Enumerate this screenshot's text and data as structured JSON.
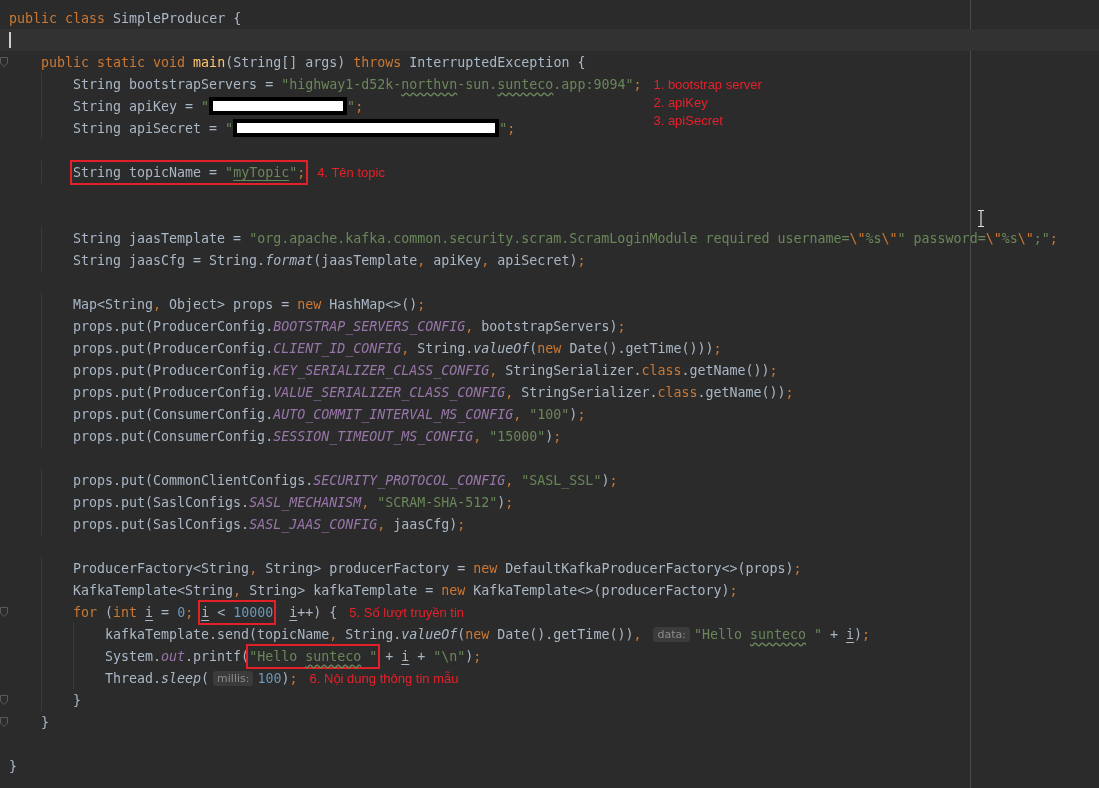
{
  "editor": {
    "lines": [
      {
        "fold": false,
        "current": false,
        "tokens": [
          {
            "kind": "keyword",
            "text": "public class "
          },
          {
            "kind": "plain",
            "text": "SimpleProducer {"
          }
        ],
        "children": [
          {
            "fold": false,
            "current": true
          },
          {
            "fold": true,
            "current": false,
            "tokens": [
              {
                "kind": "keyword",
                "text": "public static void "
              },
              {
                "kind": "method",
                "text": "main"
              },
              {
                "kind": "plain",
                "text": "(String[] args) "
              },
              {
                "kind": "keyword",
                "text": "throws "
              },
              {
                "kind": "plain",
                "text": "InterruptedException {"
              }
            ],
            "children": [
              {
                "fold": false,
                "current": false,
                "tokens": [
                  {
                    "kind": "plain",
                    "text": "String bootstrapServers = "
                  },
                  {
                    "kind": "string",
                    "text": "\"highway1-d52k-"
                  },
                  {
                    "kind": "string-wavy",
                    "text": "northvn"
                  },
                  {
                    "kind": "string",
                    "text": "-sun."
                  },
                  {
                    "kind": "string-wavy",
                    "text": "sunteco"
                  },
                  {
                    "kind": "string",
                    "text": ".app:9094\""
                  },
                  {
                    "kind": "punct",
                    "text": ";"
                  }
                ],
                "notes": [
                  "1. bootstrap server",
                  "2. apiKey",
                  "3. apiSecret"
                ]
              },
              {
                "fold": false,
                "current": false,
                "tokens": [
                  {
                    "kind": "plain",
                    "text": "String apiKey = "
                  },
                  {
                    "kind": "string",
                    "text": "\""
                  },
                  {
                    "kind": "redacted"
                  },
                  {
                    "kind": "string",
                    "text": "\""
                  },
                  {
                    "kind": "punct",
                    "text": ";"
                  }
                ]
              },
              {
                "fold": false,
                "current": false,
                "tokens": [
                  {
                    "kind": "plain",
                    "text": "String apiSecret = "
                  },
                  {
                    "kind": "string",
                    "text": "\""
                  },
                  {
                    "kind": "redacted"
                  },
                  {
                    "kind": "string",
                    "text": "\""
                  },
                  {
                    "kind": "punct",
                    "text": ";"
                  }
                ]
              },
              {
                "fold": false,
                "current": false
              },
              {
                "fold": false,
                "current": false,
                "tokens": [
                  {
                    "kind": "box",
                    "items": [
                      {
                        "kind": "plain",
                        "text": "String topicName = "
                      },
                      {
                        "kind": "string",
                        "text": "\""
                      },
                      {
                        "kind": "string-underlined",
                        "text": "myTopic"
                      },
                      {
                        "kind": "string",
                        "text": "\""
                      },
                      {
                        "kind": "punct",
                        "text": ";"
                      }
                    ]
                  }
                ],
                "notes": [
                  "4. Tên topic"
                ]
              },
              {
                "fold": false,
                "current": false
              },
              {
                "fold": false,
                "current": false
              },
              {
                "fold": false,
                "current": false,
                "tokens": [
                  {
                    "kind": "plain",
                    "text": "String jaasTemplate = "
                  },
                  {
                    "kind": "string",
                    "text": "\"org.apache.kafka.common.security.scram.ScramLoginModule required username="
                  },
                  {
                    "kind": "escape",
                    "text": "\\\""
                  },
                  {
                    "kind": "string",
                    "text": "%s"
                  },
                  {
                    "kind": "escape",
                    "text": "\\\""
                  },
                  {
                    "kind": "string",
                    "text": "\" password="
                  },
                  {
                    "kind": "escape",
                    "text": "\\\""
                  },
                  {
                    "kind": "string",
                    "text": "%s"
                  },
                  {
                    "kind": "escape",
                    "text": "\\\""
                  },
                  {
                    "kind": "string",
                    "text": ";\""
                  },
                  {
                    "kind": "punct",
                    "text": ";"
                  }
                ]
              },
              {
                "fold": false,
                "current": false,
                "tokens": [
                  {
                    "kind": "plain",
                    "text": "String jaasCfg = String."
                  },
                  {
                    "kind": "italic",
                    "text": "format"
                  },
                  {
                    "kind": "plain",
                    "text": "(jaasTemplate"
                  },
                  {
                    "kind": "punct",
                    "text": ", "
                  },
                  {
                    "kind": "plain",
                    "text": "apiKey"
                  },
                  {
                    "kind": "punct",
                    "text": ", "
                  },
                  {
                    "kind": "plain",
                    "text": "apiSecret)"
                  },
                  {
                    "kind": "punct",
                    "text": ";"
                  }
                ]
              },
              {
                "fold": false,
                "current": false
              },
              {
                "fold": false,
                "current": false,
                "tokens": [
                  {
                    "kind": "plain",
                    "text": "Map<String"
                  },
                  {
                    "kind": "punct",
                    "text": ", "
                  },
                  {
                    "kind": "plain",
                    "text": "Object> props = "
                  },
                  {
                    "kind": "keyword",
                    "text": "new "
                  },
                  {
                    "kind": "plain",
                    "text": "HashMap<>()"
                  },
                  {
                    "kind": "punct",
                    "text": ";"
                  }
                ]
              },
              {
                "fold": false,
                "current": false,
                "tokens": [
                  {
                    "kind": "plain",
                    "text": "props.put(ProducerConfig."
                  },
                  {
                    "kind": "constant",
                    "text": "BOOTSTRAP_SERVERS_CONFIG"
                  },
                  {
                    "kind": "punct",
                    "text": ", "
                  },
                  {
                    "kind": "plain",
                    "text": "bootstrapServers)"
                  },
                  {
                    "kind": "punct",
                    "text": ";"
                  }
                ]
              },
              {
                "fold": false,
                "current": false,
                "tokens": [
                  {
                    "kind": "plain",
                    "text": "props.put(ProducerConfig."
                  },
                  {
                    "kind": "constant",
                    "text": "CLIENT_ID_CONFIG"
                  },
                  {
                    "kind": "punct",
                    "text": ", "
                  },
                  {
                    "kind": "plain",
                    "text": "String."
                  },
                  {
                    "kind": "italic",
                    "text": "valueOf"
                  },
                  {
                    "kind": "plain",
                    "text": "("
                  },
                  {
                    "kind": "keyword",
                    "text": "new "
                  },
                  {
                    "kind": "plain",
                    "text": "Date().getTime()))"
                  },
                  {
                    "kind": "punct",
                    "text": ";"
                  }
                ]
              },
              {
                "fold": false,
                "current": false,
                "tokens": [
                  {
                    "kind": "plain",
                    "text": "props.put(ProducerConfig."
                  },
                  {
                    "kind": "constant",
                    "text": "KEY_SERIALIZER_CLASS_CONFIG"
                  },
                  {
                    "kind": "punct",
                    "text": ", "
                  },
                  {
                    "kind": "plain",
                    "text": "StringSerializer."
                  },
                  {
                    "kind": "keyword",
                    "text": "class"
                  },
                  {
                    "kind": "plain",
                    "text": ".getName())"
                  },
                  {
                    "kind": "punct",
                    "text": ";"
                  }
                ]
              },
              {
                "fold": false,
                "current": false,
                "tokens": [
                  {
                    "kind": "plain",
                    "text": "props.put(ProducerConfig."
                  },
                  {
                    "kind": "constant",
                    "text": "VALUE_SERIALIZER_CLASS_CONFIG"
                  },
                  {
                    "kind": "punct",
                    "text": ", "
                  },
                  {
                    "kind": "plain",
                    "text": "StringSerializer."
                  },
                  {
                    "kind": "keyword",
                    "text": "class"
                  },
                  {
                    "kind": "plain",
                    "text": ".getName())"
                  },
                  {
                    "kind": "punct",
                    "text": ";"
                  }
                ]
              },
              {
                "fold": false,
                "current": false,
                "tokens": [
                  {
                    "kind": "plain",
                    "text": "props.put(ConsumerConfig."
                  },
                  {
                    "kind": "constant",
                    "text": "AUTO_COMMIT_INTERVAL_MS_CONFIG"
                  },
                  {
                    "kind": "punct",
                    "text": ", "
                  },
                  {
                    "kind": "string",
                    "text": "\"100\""
                  },
                  {
                    "kind": "plain",
                    "text": ")"
                  },
                  {
                    "kind": "punct",
                    "text": ";"
                  }
                ]
              },
              {
                "fold": false,
                "current": false,
                "tokens": [
                  {
                    "kind": "plain",
                    "text": "props.put(ConsumerConfig."
                  },
                  {
                    "kind": "constant",
                    "text": "SESSION_TIMEOUT_MS_CONFIG"
                  },
                  {
                    "kind": "punct",
                    "text": ", "
                  },
                  {
                    "kind": "string",
                    "text": "\"15000\""
                  },
                  {
                    "kind": "plain",
                    "text": ")"
                  },
                  {
                    "kind": "punct",
                    "text": ";"
                  }
                ]
              },
              {
                "fold": false,
                "current": false
              },
              {
                "fold": false,
                "current": false,
                "tokens": [
                  {
                    "kind": "plain",
                    "text": "props.put(CommonClientConfigs."
                  },
                  {
                    "kind": "constant",
                    "text": "SECURITY_PROTOCOL_CONFIG"
                  },
                  {
                    "kind": "punct",
                    "text": ", "
                  },
                  {
                    "kind": "string",
                    "text": "\"SASL_SSL\""
                  },
                  {
                    "kind": "plain",
                    "text": ")"
                  },
                  {
                    "kind": "punct",
                    "text": ";"
                  }
                ]
              },
              {
                "fold": false,
                "current": false,
                "tokens": [
                  {
                    "kind": "plain",
                    "text": "props.put(SaslConfigs."
                  },
                  {
                    "kind": "constant",
                    "text": "SASL_MECHANISM"
                  },
                  {
                    "kind": "punct",
                    "text": ", "
                  },
                  {
                    "kind": "string",
                    "text": "\"SCRAM-SHA-512\""
                  },
                  {
                    "kind": "plain",
                    "text": ")"
                  },
                  {
                    "kind": "punct",
                    "text": ";"
                  }
                ]
              },
              {
                "fold": false,
                "current": false,
                "tokens": [
                  {
                    "kind": "plain",
                    "text": "props.put(SaslConfigs."
                  },
                  {
                    "kind": "constant",
                    "text": "SASL_JAAS_CONFIG"
                  },
                  {
                    "kind": "punct",
                    "text": ", "
                  },
                  {
                    "kind": "plain",
                    "text": "jaasCfg)"
                  },
                  {
                    "kind": "punct",
                    "text": ";"
                  }
                ]
              },
              {
                "fold": false,
                "current": false
              },
              {
                "fold": false,
                "current": false,
                "tokens": [
                  {
                    "kind": "plain",
                    "text": "ProducerFactory<String"
                  },
                  {
                    "kind": "punct",
                    "text": ", "
                  },
                  {
                    "kind": "plain",
                    "text": "String> producerFactory = "
                  },
                  {
                    "kind": "keyword",
                    "text": "new "
                  },
                  {
                    "kind": "plain",
                    "text": "DefaultKafkaProducerFactory<>(props)"
                  },
                  {
                    "kind": "punct",
                    "text": ";"
                  }
                ]
              },
              {
                "fold": false,
                "current": false,
                "tokens": [
                  {
                    "kind": "plain",
                    "text": "KafkaTemplate<String"
                  },
                  {
                    "kind": "punct",
                    "text": ", "
                  },
                  {
                    "kind": "plain",
                    "text": "String> kafkaTemplate = "
                  },
                  {
                    "kind": "keyword",
                    "text": "new "
                  },
                  {
                    "kind": "plain",
                    "text": "KafkaTemplate<>(producerFactory)"
                  },
                  {
                    "kind": "punct",
                    "text": ";"
                  }
                ]
              },
              {
                "fold": true,
                "current": false,
                "tokens": [
                  {
                    "kind": "keyword",
                    "text": "for "
                  },
                  {
                    "kind": "plain",
                    "text": "("
                  },
                  {
                    "kind": "keyword",
                    "text": "int "
                  },
                  {
                    "kind": "variable",
                    "text": "i"
                  },
                  {
                    "kind": "plain",
                    "text": " = "
                  },
                  {
                    "kind": "number",
                    "text": "0"
                  },
                  {
                    "kind": "punct",
                    "text": "; "
                  },
                  {
                    "kind": "box",
                    "items": [
                      {
                        "kind": "variable",
                        "text": "i"
                      },
                      {
                        "kind": "plain",
                        "text": " < "
                      },
                      {
                        "kind": "number",
                        "text": "10000"
                      }
                    ]
                  },
                  {
                    "kind": "variable",
                    "text": "i"
                  },
                  {
                    "kind": "plain",
                    "text": "++) {"
                  }
                ],
                "notes": [
                  "5. Số lượt truyền tin"
                ],
                "children": [
                  {
                    "fold": false,
                    "current": false,
                    "tokens": [
                      {
                        "kind": "plain",
                        "text": "kafkaTemplate.send(topicName"
                      },
                      {
                        "kind": "punct",
                        "text": ", "
                      },
                      {
                        "kind": "plain",
                        "text": "String."
                      },
                      {
                        "kind": "italic",
                        "text": "valueOf"
                      },
                      {
                        "kind": "plain",
                        "text": "("
                      },
                      {
                        "kind": "keyword",
                        "text": "new "
                      },
                      {
                        "kind": "plain",
                        "text": "Date().getTime())"
                      },
                      {
                        "kind": "punct",
                        "text": ", "
                      },
                      {
                        "kind": "hint",
                        "text": "data:"
                      },
                      {
                        "kind": "string",
                        "text": "\"Hello "
                      },
                      {
                        "kind": "string-wavy",
                        "text": "sunteco"
                      },
                      {
                        "kind": "string",
                        "text": " \""
                      },
                      {
                        "kind": "plain",
                        "text": " + "
                      },
                      {
                        "kind": "variable",
                        "text": "i"
                      },
                      {
                        "kind": "plain",
                        "text": ")"
                      },
                      {
                        "kind": "punct",
                        "text": ";"
                      }
                    ]
                  },
                  {
                    "fold": false,
                    "current": false,
                    "tokens": [
                      {
                        "kind": "plain",
                        "text": "System."
                      },
                      {
                        "kind": "constant",
                        "text": "out"
                      },
                      {
                        "kind": "plain",
                        "text": ".printf("
                      },
                      {
                        "kind": "box",
                        "items": [
                          {
                            "kind": "string",
                            "text": "\"Hello "
                          },
                          {
                            "kind": "string-wavy",
                            "text": "sunteco"
                          },
                          {
                            "kind": "string",
                            "text": " \""
                          }
                        ]
                      },
                      {
                        "kind": "plain",
                        "text": " + "
                      },
                      {
                        "kind": "variable",
                        "text": "i"
                      },
                      {
                        "kind": "plain",
                        "text": " + "
                      },
                      {
                        "kind": "string",
                        "text": "\"\\n\""
                      },
                      {
                        "kind": "plain",
                        "text": ")"
                      },
                      {
                        "kind": "punct",
                        "text": ";"
                      }
                    ]
                  },
                  {
                    "fold": false,
                    "current": false,
                    "tokens": [
                      {
                        "kind": "plain",
                        "text": "Thread."
                      },
                      {
                        "kind": "italic",
                        "text": "sleep"
                      },
                      {
                        "kind": "plain",
                        "text": "("
                      },
                      {
                        "kind": "hint",
                        "text": "millis:"
                      },
                      {
                        "kind": "number",
                        "text": "100"
                      },
                      {
                        "kind": "plain",
                        "text": ")"
                      },
                      {
                        "kind": "punct",
                        "text": ";"
                      }
                    ],
                    "notes": [
                      "6. Nội dung thông tin mẫu"
                    ]
                  }
                ]
              },
              {
                "fold": true,
                "current": false,
                "tokens": [
                  {
                    "kind": "plain",
                    "text": "}"
                  }
                ]
              }
            ]
          },
          {
            "fold": true,
            "current": false,
            "tokens": [
              {
                "kind": "plain",
                "text": "}"
              }
            ]
          }
        ]
      },
      {
        "fold": false,
        "current": false
      },
      {
        "fold": false,
        "current": false,
        "tokens": [
          {
            "kind": "plain",
            "text": "}"
          }
        ]
      }
    ]
  }
}
